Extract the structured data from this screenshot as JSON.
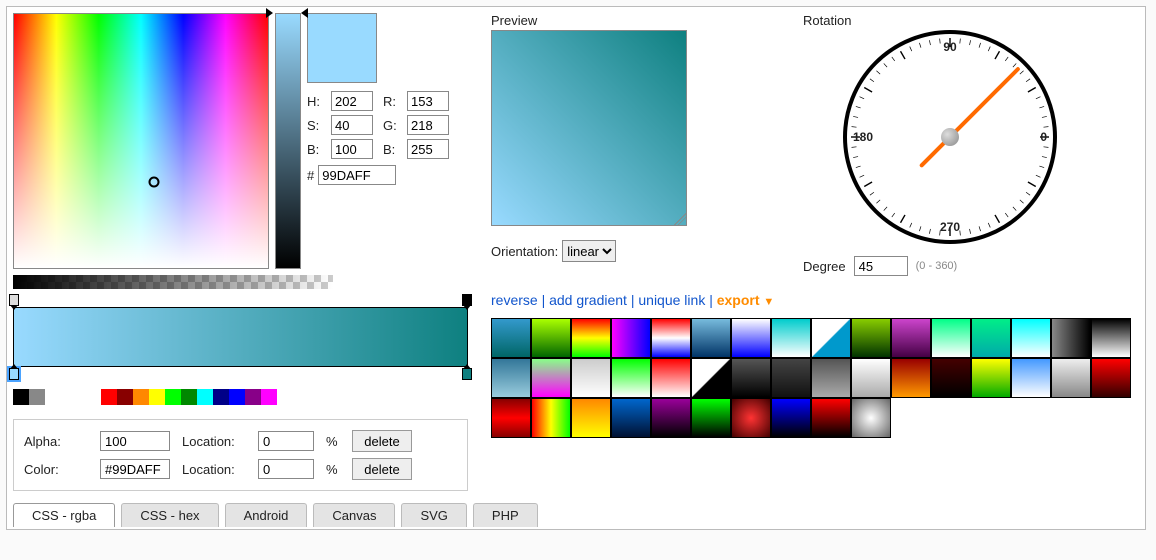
{
  "picker": {
    "labels": {
      "H": "H:",
      "S": "S:",
      "Bv": "B:",
      "R": "R:",
      "G": "G:",
      "Bc": "B:",
      "hash": "#"
    },
    "H": "202",
    "S": "40",
    "Bv": "100",
    "R": "153",
    "G": "218",
    "Bc": "255",
    "hex": "99DAFF",
    "swatchColor": "#99DAFF"
  },
  "stops": {
    "alpha": {
      "label": "Alpha:",
      "value": "100",
      "locLabel": "Location:",
      "loc": "0",
      "pct": "%",
      "del": "delete"
    },
    "color": {
      "label": "Color:",
      "value": "#99DAFF",
      "locLabel": "Location:",
      "loc": "0",
      "pct": "%",
      "del": "delete"
    }
  },
  "quickSwatches": [
    "#000",
    "#888",
    "#fff",
    "#f00",
    "#800",
    "#f80",
    "#ff0",
    "#0f0",
    "#080",
    "#0ff",
    "#008",
    "#00f",
    "#808",
    "#f0f"
  ],
  "preview": {
    "label": "Preview",
    "orientationLabel": "Orientation:",
    "orientation": "linear"
  },
  "links": {
    "reverse": "reverse",
    "add": "add gradient",
    "unique": "unique link",
    "export": "export"
  },
  "rotation": {
    "label": "Rotation",
    "n": "90",
    "e": "0",
    "s": "270",
    "w": "180",
    "degreeLabel": "Degree",
    "degree": "45",
    "hint": "(0 - 360)"
  },
  "presets": [
    "linear-gradient(#39c,#066)",
    "linear-gradient(#af0,#060)",
    "linear-gradient(#f00,#ff0,#0f0)",
    "linear-gradient(90deg,#f0f,#00f)",
    "linear-gradient(#f00,#fff,#00f)",
    "linear-gradient(#7bd,#036)",
    "linear-gradient(#fff,#00f)",
    "linear-gradient(#0cc,#fff)",
    "linear-gradient(135deg,#fff 49%,#09c 51%)",
    "linear-gradient(#8c0,#030)",
    "linear-gradient(#c4c,#404)",
    "linear-gradient(#0f8,#fff)",
    "linear-gradient(#0e8,#0aa)",
    "linear-gradient(#0ff,#fff)",
    "linear-gradient(90deg,#888,#000)",
    "linear-gradient(#000,#fff)",
    "linear-gradient(#379,#9cd)",
    "linear-gradient(#8f8,#f0f)",
    "linear-gradient(#ccc,#fff)",
    "linear-gradient(#0f0,#fff)",
    "linear-gradient(#f00,#fff)",
    "linear-gradient(135deg,#fff 49%,#000 51%)",
    "linear-gradient(#555,#000)",
    "linear-gradient(#444,#111)",
    "linear-gradient(#555,#aaa)",
    "linear-gradient(#fff,#aaa)",
    "linear-gradient(#900,#f90)",
    "linear-gradient(#400,#000)",
    "linear-gradient(#ff0,#0a0)",
    "linear-gradient(#49f,#fff)",
    "linear-gradient(#eee,#888)",
    "linear-gradient(#f00,#300)",
    "linear-gradient(#800,#f00,#800)",
    "linear-gradient(90deg,#f00,#ff0,#0f0)",
    "linear-gradient(#f80,#ff0)",
    "linear-gradient(#06c,#013)",
    "linear-gradient(#909,#000)",
    "linear-gradient(#0f0,#000)",
    "radial-gradient(#f33,#400)",
    "linear-gradient(#00f,#000)",
    "linear-gradient(#f00,#000)",
    "radial-gradient(#fff,#666)"
  ],
  "tabs": [
    "CSS - rgba",
    "CSS - hex",
    "Android",
    "Canvas",
    "SVG",
    "PHP"
  ],
  "activeTab": 0
}
